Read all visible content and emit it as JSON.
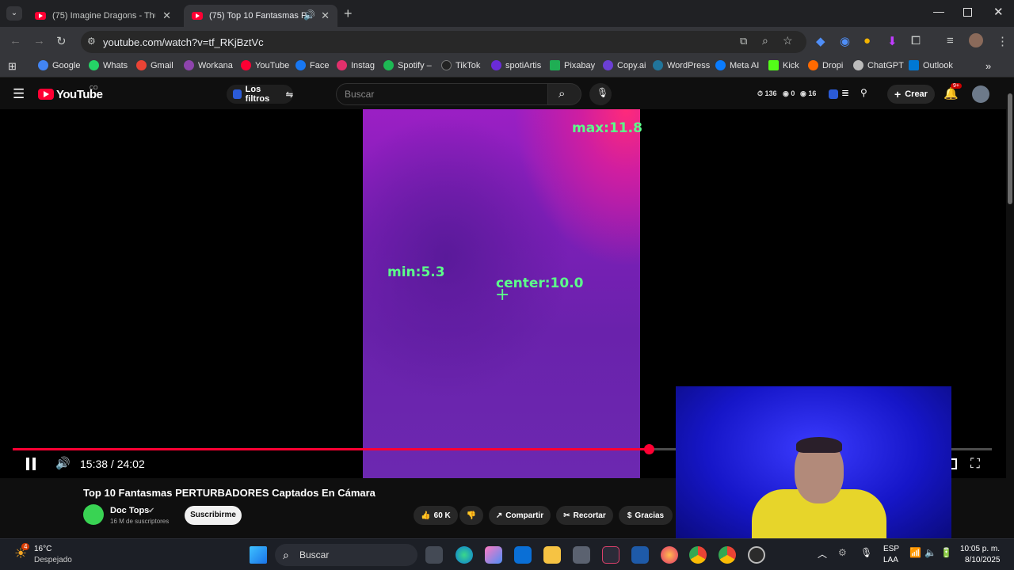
{
  "browser": {
    "tabs": [
      {
        "title": "(75) Imagine Dragons - Thunde",
        "active": false
      },
      {
        "title": "(75) Top 10 Fantasmas PERT",
        "active": true
      }
    ],
    "url": "youtube.com/watch?v=tf_RKjBztVc",
    "bookmarks": [
      "Google",
      "Whats",
      "Gmail",
      "Workana",
      "YouTube",
      "Face",
      "Instag",
      "Spotify –",
      "TikTok",
      "spotiArtis",
      "Pixabay",
      "Copy.ai",
      "WordPress",
      "Meta AI",
      "Kick",
      "Dropi",
      "ChatGPT",
      "Outlook"
    ],
    "bookmark_colors": [
      "#4285f4",
      "#25d366",
      "#ea4335",
      "#8e44ad",
      "#ff0033",
      "#1877f2",
      "#e1306c",
      "#1db954",
      "#222222",
      "#6a2bd9",
      "#1fae54",
      "#6b3fd4",
      "#21759b",
      "#0a7cff",
      "#53fc18",
      "#ff6a00",
      "#bbbbbb",
      "#0078d4"
    ]
  },
  "youtube": {
    "logo_text": "YouTube",
    "logo_superscript": "CO",
    "filters_label": "Los filtros",
    "search_placeholder": "Buscar",
    "stats": [
      "136",
      "0",
      "16"
    ],
    "create_label": "Crear",
    "notifications_badge": "9+"
  },
  "player": {
    "overlay": {
      "max": "max:11.8",
      "min": "min:5.3",
      "center": "center:10.0"
    },
    "time_current": "15:38",
    "time_total": "24:02",
    "time_display": "15:38 / 24:02",
    "progress": 0.65
  },
  "video": {
    "title": "Top 10 Fantasmas PERTURBADORES Captados En Cámara",
    "channel": "Doc Tops",
    "subscribers": "16 M de suscriptores",
    "subscribe_label": "Suscribirme",
    "likes": "60 K",
    "share_label": "Compartir",
    "clip_label": "Recortar",
    "thanks_label": "Gracias"
  },
  "taskbar": {
    "weather_badge": "4",
    "weather_temp": "16°C",
    "weather_desc": "Despejado",
    "search_placeholder": "Buscar",
    "lang_top": "ESP",
    "lang_bottom": "LAA",
    "time": "10:05 p. m.",
    "date": "8/10/2025"
  }
}
